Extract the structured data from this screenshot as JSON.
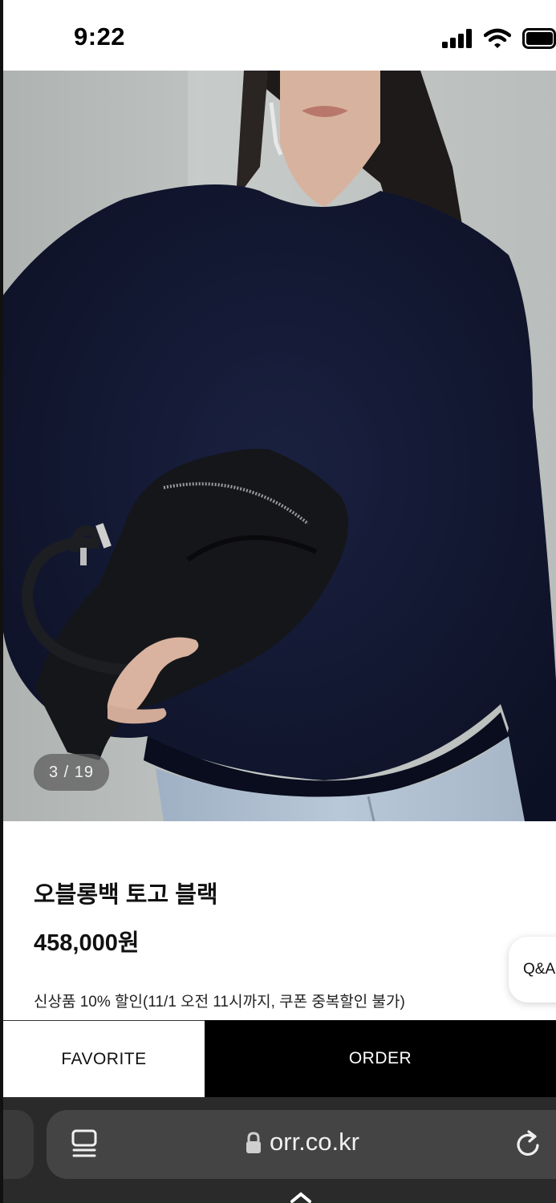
{
  "status_bar": {
    "time": "9:22"
  },
  "gallery": {
    "counter": "3 / 19"
  },
  "product": {
    "name": "오블롱백 토고 블랙",
    "price": "458,000원",
    "promo": "신상품 10% 할인(11/1 오전 11시까지, 쿠폰 중복할인 불가)"
  },
  "qa_button": "Q&A",
  "actions": {
    "favorite": "FAVORITE",
    "order": "ORDER"
  },
  "browser": {
    "url": "orr.co.kr"
  },
  "colors": {
    "order_bg": "#000000",
    "browser_bar": "#2a2a2a",
    "sweater": "#141a33"
  },
  "icons": [
    "signal-icon",
    "wifi-icon",
    "battery-icon",
    "reader-icon",
    "lock-icon",
    "reload-icon"
  ]
}
